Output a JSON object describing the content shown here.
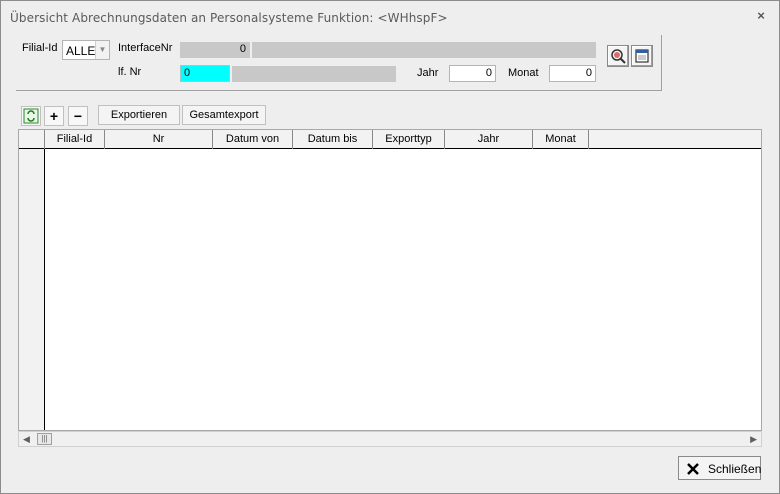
{
  "window": {
    "title": "Übersicht Abrechnungsdaten an Personalsysteme  Funktion: <WHhspF>",
    "close_glyph": "×"
  },
  "filters": {
    "filial_label": "Filial-Id",
    "filial_value": "ALLE",
    "interface_label": "InterfaceNr",
    "interface_value": "0",
    "lfnr_label": "lf. Nr",
    "lfnr_value": "0",
    "jahr_label": "Jahr",
    "jahr_value": "0",
    "monat_label": "Monat",
    "monat_value": "0"
  },
  "toolbar": {
    "refresh_icon": "refresh-icon",
    "add_glyph": "+",
    "remove_glyph": "−",
    "export_label": "Exportieren",
    "gesamtexport_label": "Gesamtexport"
  },
  "grid": {
    "columns": [
      "Filial-Id",
      "Nr",
      "Datum von",
      "Datum bis",
      "Exporttyp",
      "Jahr",
      "Monat"
    ],
    "rows": []
  },
  "footer": {
    "close_label": "Schließen"
  },
  "colors": {
    "highlight_field": "#00ffff",
    "disabled_field": "#c8c8c8"
  }
}
